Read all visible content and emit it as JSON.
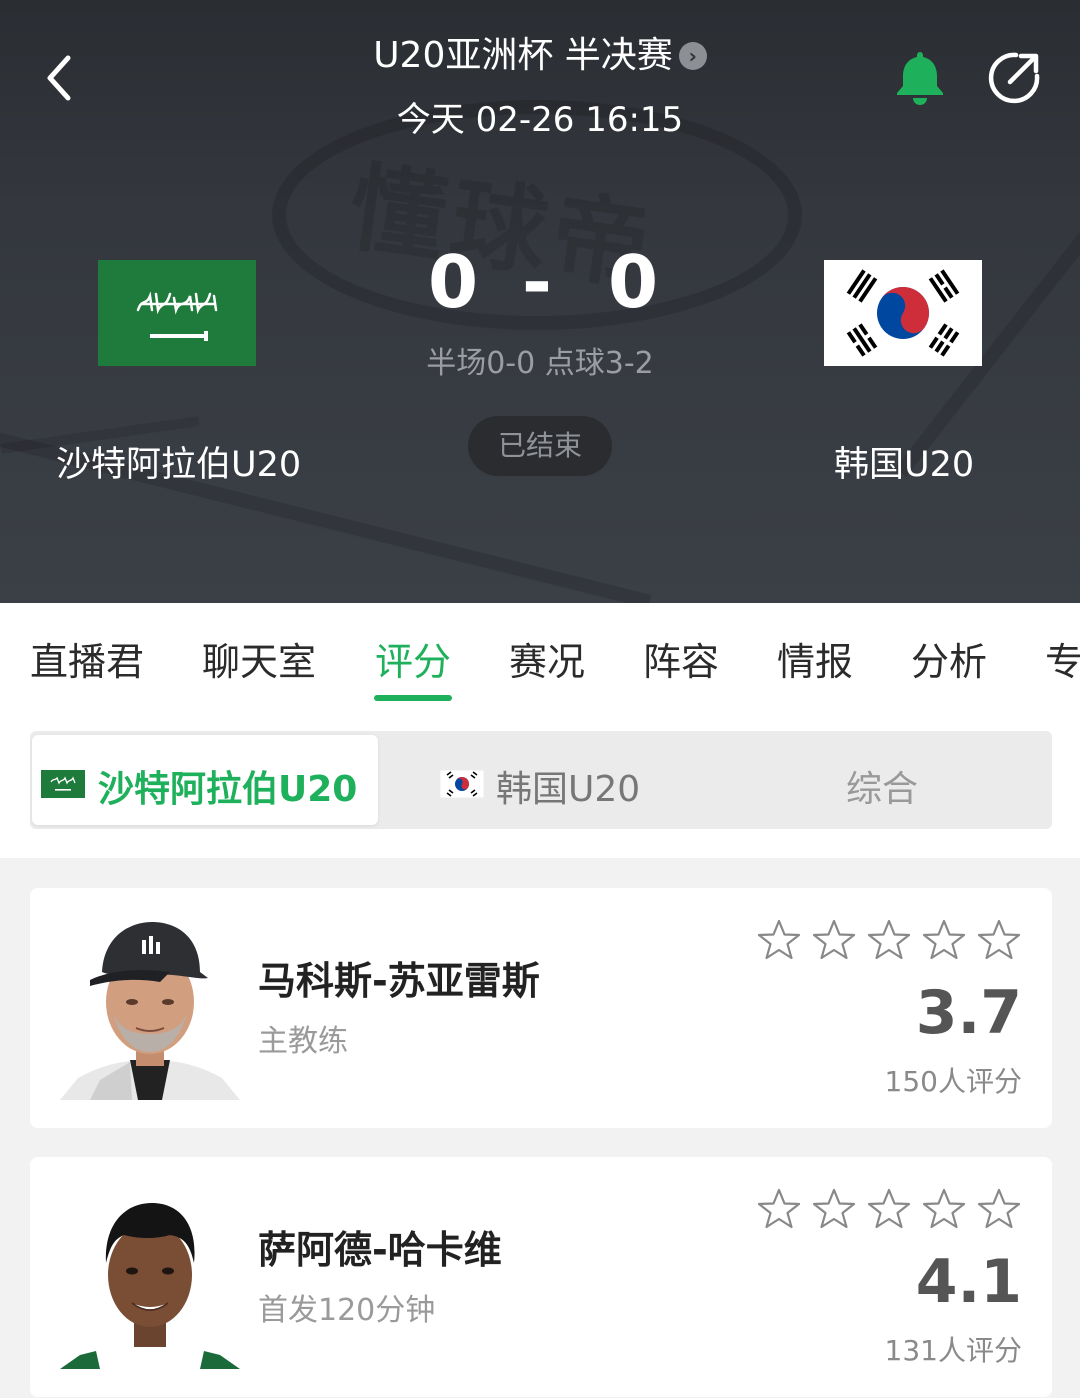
{
  "header": {
    "match_title": "U20亚洲杯 半决赛",
    "match_time": "今天 02-26 16:15",
    "watermark": "懂球帝",
    "home_team": "沙特阿拉伯U20",
    "away_team": "韩国U20",
    "home_score": "0",
    "score_separator": "-",
    "away_score": "0",
    "score_detail": "半场0-0 点球3-2",
    "status": "已结束",
    "icons": {
      "back": "chevron-left-icon",
      "title_arrow": "chevron-right-circle-icon",
      "bell": "bell-icon",
      "share": "share-icon"
    },
    "bell_color": "#1fb05c"
  },
  "tabs": [
    {
      "label": "直播君",
      "active": false
    },
    {
      "label": "聊天室",
      "active": false
    },
    {
      "label": "评分",
      "active": true
    },
    {
      "label": "赛况",
      "active": false
    },
    {
      "label": "阵容",
      "active": false
    },
    {
      "label": "情报",
      "active": false
    },
    {
      "label": "分析",
      "active": false
    },
    {
      "label": "专",
      "active": false
    }
  ],
  "team_selector": {
    "options": [
      {
        "label": "沙特阿拉伯U20",
        "active": true
      },
      {
        "label": "韩国U20",
        "active": false
      },
      {
        "label": "综合",
        "active": false
      }
    ]
  },
  "ratings": [
    {
      "name": "马科斯-苏亚雷斯",
      "role": "主教练",
      "rating": "3.7",
      "stars": 0,
      "votes": "150人评分"
    },
    {
      "name": "萨阿德-哈卡维",
      "role": "首发120分钟",
      "rating": "4.1",
      "stars": 0,
      "votes": "131人评分"
    }
  ],
  "colors": {
    "accent": "#1fb05c",
    "header_bg": "#34383e",
    "saudi_green": "#1e7b3c",
    "korea_red": "#cd2e3a",
    "korea_blue": "#0047a0"
  }
}
